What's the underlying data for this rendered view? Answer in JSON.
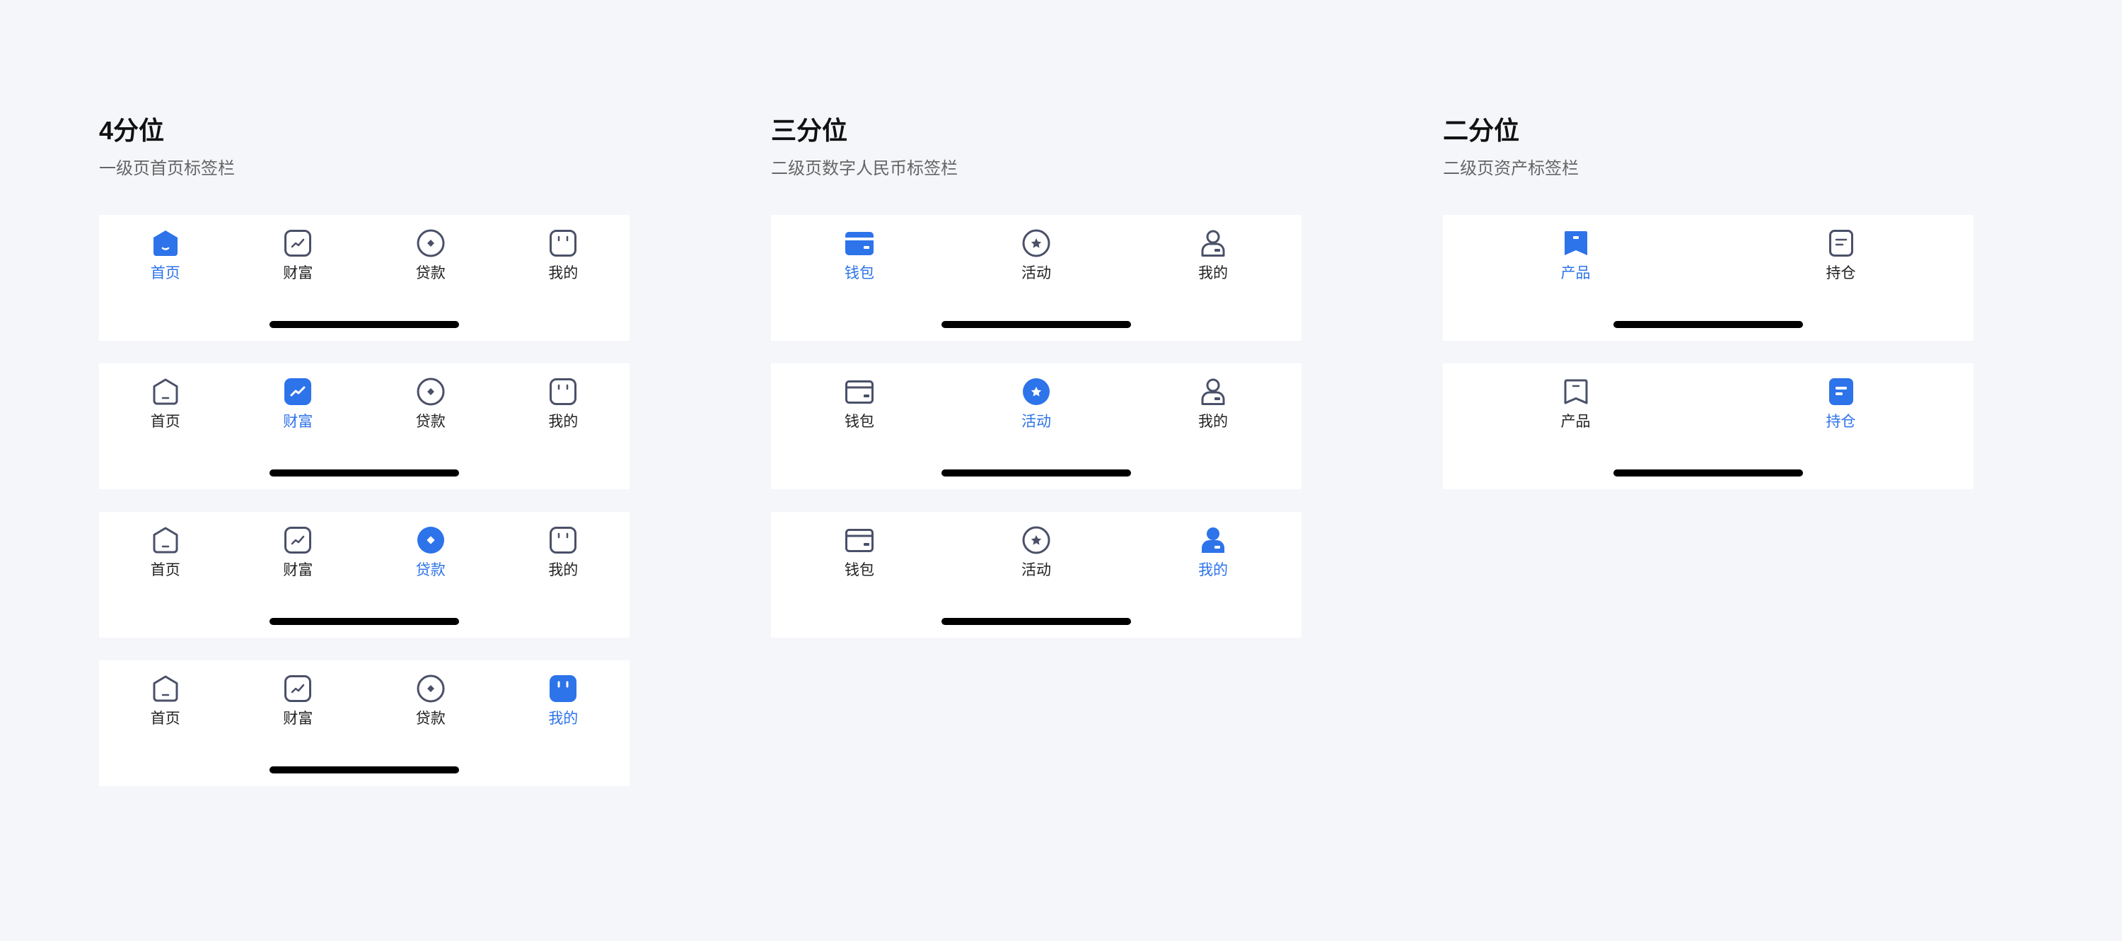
{
  "colors": {
    "active": "#2d73ea",
    "inactive": "#4a5068",
    "background": "#f5f6fa",
    "bar": "#ffffff",
    "indicator": "#000000"
  },
  "groups": [
    {
      "title": "4分位",
      "subtitle": "一级页首页标签栏",
      "tabs": [
        {
          "label": "首页",
          "icon": "home-icon"
        },
        {
          "label": "财富",
          "icon": "wealth-icon"
        },
        {
          "label": "贷款",
          "icon": "loan-icon"
        },
        {
          "label": "我的",
          "icon": "mine-icon"
        }
      ],
      "bars": [
        {
          "active": 0
        },
        {
          "active": 1
        },
        {
          "active": 2
        },
        {
          "active": 3
        }
      ]
    },
    {
      "title": "三分位",
      "subtitle": "二级页数字人民币标签栏",
      "tabs": [
        {
          "label": "钱包",
          "icon": "wallet-icon"
        },
        {
          "label": "活动",
          "icon": "activity-icon"
        },
        {
          "label": "我的",
          "icon": "user-icon"
        }
      ],
      "bars": [
        {
          "active": 0
        },
        {
          "active": 1
        },
        {
          "active": 2
        }
      ]
    },
    {
      "title": "二分位",
      "subtitle": "二级页资产标签栏",
      "tabs": [
        {
          "label": "产品",
          "icon": "product-icon"
        },
        {
          "label": "持仓",
          "icon": "holding-icon"
        }
      ],
      "bars": [
        {
          "active": 0
        },
        {
          "active": 1
        }
      ]
    }
  ]
}
